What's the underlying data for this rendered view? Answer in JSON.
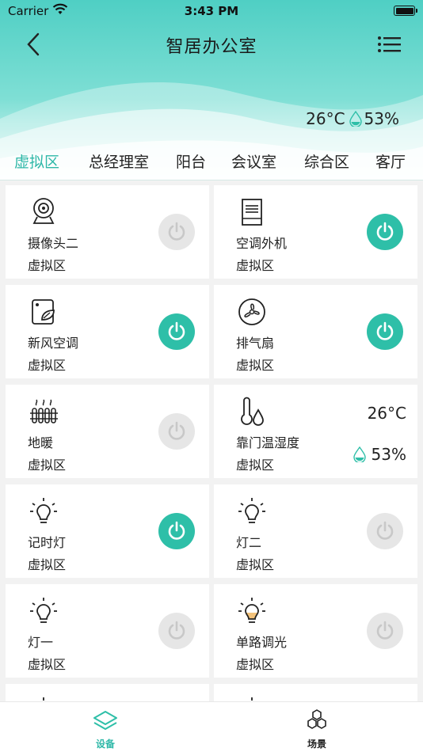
{
  "status_bar": {
    "carrier": "Carrier",
    "time": "3:43 PM"
  },
  "nav": {
    "title": "智居办公室",
    "back_icon": "chevron-left-icon",
    "menu_icon": "list-icon"
  },
  "climate": {
    "temperature": "26°C",
    "humidity": "53%"
  },
  "tabs": [
    {
      "label": "虚拟区",
      "active": true
    },
    {
      "label": "总经理室"
    },
    {
      "label": "阳台"
    },
    {
      "label": "会议室"
    },
    {
      "label": "综合区"
    },
    {
      "label": "客厅"
    }
  ],
  "devices": [
    {
      "name": "摄像头二",
      "room": "虚拟区",
      "icon": "camera-icon",
      "power": "off"
    },
    {
      "name": "空调外机",
      "room": "虚拟区",
      "icon": "ac-outdoor-icon",
      "power": "on"
    },
    {
      "name": "新风空调",
      "room": "虚拟区",
      "icon": "fresh-air-icon",
      "power": "on"
    },
    {
      "name": "排气扇",
      "room": "虚拟区",
      "icon": "fan-icon",
      "power": "on"
    },
    {
      "name": "地暖",
      "room": "虚拟区",
      "icon": "floor-heating-icon",
      "power": "off"
    },
    {
      "name": "靠门温湿度",
      "room": "虚拟区",
      "icon": "thermo-hygrometer-icon",
      "temperature": "26°C",
      "humidity": "53%"
    },
    {
      "name": "记时灯",
      "room": "虚拟区",
      "icon": "light-bulb-icon",
      "power": "on"
    },
    {
      "name": "灯二",
      "room": "虚拟区",
      "icon": "light-bulb-icon",
      "power": "off"
    },
    {
      "name": "灯一",
      "room": "虚拟区",
      "icon": "light-bulb-icon",
      "power": "off"
    },
    {
      "name": "单路调光",
      "room": "虚拟区",
      "icon": "dimmer-bulb-icon",
      "power": "off"
    }
  ],
  "tabbar": [
    {
      "label": "设备",
      "icon": "layers-icon",
      "active": true
    },
    {
      "label": "场景",
      "icon": "hexagons-icon"
    }
  ],
  "colors": {
    "accent": "#2ebfa8",
    "off": "#e6e6e6"
  }
}
